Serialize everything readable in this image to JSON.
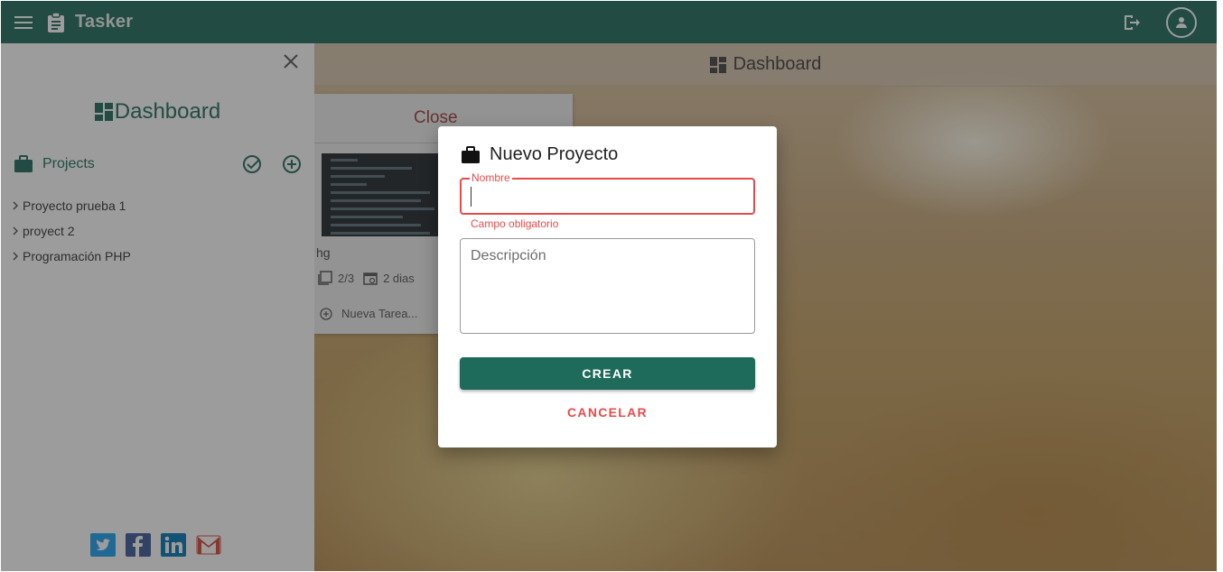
{
  "appbar": {
    "title": "Tasker",
    "menu_icon": "menu-icon",
    "logo_icon": "clipboard-icon",
    "logout_icon": "logout-icon",
    "account_icon": "account-icon",
    "color": "#1e6b5c"
  },
  "sidebar": {
    "dashboard_label": "Dashboard",
    "projects_label": "Projects",
    "projects": [
      {
        "label": "Proyecto prueba 1"
      },
      {
        "label": "proyect 2"
      },
      {
        "label": "Programación PHP"
      }
    ],
    "social": [
      "twitter-icon",
      "facebook-icon",
      "linkedin-icon",
      "gmail-icon"
    ]
  },
  "main": {
    "header_label": "Dashboard",
    "card": {
      "close_label": "Close",
      "name": "hg",
      "subtasks": "2/3",
      "due": "2 dias",
      "new_task": "Nueva Tarea..."
    }
  },
  "dialog": {
    "title": "Nuevo Proyecto",
    "name_label": "Nombre",
    "name_value": "",
    "name_error": "Campo obligatorio",
    "description_placeholder": "Descripción",
    "create_label": "CREAR",
    "cancel_label": "CANCELAR",
    "error_color": "#e84a4a"
  }
}
